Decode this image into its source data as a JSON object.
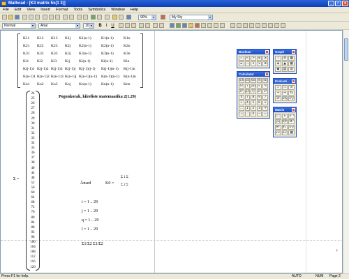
{
  "window": {
    "title": "Mathcad - [K3 matrix 5x(1 3)]"
  },
  "menu": [
    "File",
    "Edit",
    "View",
    "Insert",
    "Format",
    "Tools",
    "Symbolics",
    "Window",
    "Help"
  ],
  "toolbar": {
    "zoom": "90%",
    "style_combo": "My Sty"
  },
  "format_bar": {
    "style": "Normal",
    "font": "Arial",
    "size": "10",
    "bold": "B",
    "italic": "I",
    "underline": "U"
  },
  "matrix": {
    "rows": [
      [
        "K11",
        "K12",
        "K13",
        "K1j",
        "K1(n-1)",
        "K1(n-1)",
        "K1n"
      ],
      [
        "K21",
        "K22",
        "K23",
        "K2j",
        "K2(n-1)",
        "K2(n-1)",
        "K2n"
      ],
      [
        "K31",
        "K32",
        "K33",
        "K3j",
        "K3(n-1)",
        "K3(n-1)",
        "K3n"
      ],
      [
        "Ki1",
        "Ki2",
        "Ki3",
        "Kij",
        "Ki(n-1)",
        "Ki(n-1)",
        "Kin"
      ],
      [
        "K(j-1)1",
        "K(j-1)2",
        "K(j-1)3",
        "K(j-1)j",
        "K(j-1)(j-1)",
        "K(j-1)(n-1)",
        "K(j-1)n"
      ],
      [
        "K(n-1)1",
        "K(n-1)2",
        "K(n-1)3",
        "K(n-1)j",
        "K(n-1)(n-1)",
        "K(n-1)(n-1)",
        "K(n-1)n"
      ],
      [
        "Kn1",
        "Kn2",
        "Kn3",
        "Knj",
        "Kn(n-1)",
        "Kn(n-1)",
        "Knn"
      ]
    ]
  },
  "vector": {
    "label": "Σ =",
    "values": [
      "24",
      "25",
      "26",
      "27",
      "28",
      "29",
      "30",
      "31",
      "32",
      "33",
      "34",
      "35",
      "36",
      "37",
      "38",
      "40",
      "44",
      "48",
      "52",
      "56",
      "60",
      "64",
      "68",
      "72",
      "76",
      "80",
      "84",
      "88",
      "92",
      "96",
      "100",
      "104",
      "108",
      "112",
      "116",
      "120"
    ]
  },
  "notes": {
    "heading": "Pogonkorak, kiireliste matemaatika  2(1.29)",
    "ansed": "Ånsed",
    "k_eq": "K0 =",
    "frac_top": "Σ 1 Σ",
    "frac_bot": "Σ 2 Σ",
    "i_range": "i = 1 .. 29",
    "j_range": "j = 1 .. 29",
    "q_range": "q = 1 .. 29",
    "l_range": "l = 1 .. 29",
    "ratio": "Σ1/Σ2  Σ1/Σ2"
  },
  "palettes": {
    "boolean": {
      "title": "Boolean",
      "buttons": [
        "=",
        "<",
        ">",
        "≤",
        "≥",
        "≠",
        "¬",
        "∧",
        "∨",
        "⊕"
      ]
    },
    "graph": {
      "title": "Graph",
      "buttons": [
        "⌇",
        "⊛",
        "▦",
        "◈",
        "▲",
        "▦",
        "◆",
        "▤",
        "◍"
      ]
    },
    "calculator": {
      "title": "Calculator",
      "buttons": [
        "sin",
        "cos",
        "tan",
        "ln",
        "log",
        "n!",
        "i",
        "|x|",
        "√",
        "ⁿ√",
        "eˣ",
        "1/x",
        "()",
        "x²",
        "xʸ",
        "π",
        "7",
        "8",
        "9",
        "/",
        "÷",
        "4",
        "5",
        "6",
        "×",
        "…",
        "1",
        "2",
        "3",
        "+",
        ":=",
        ".",
        "0",
        "−",
        "="
      ]
    },
    "evaluation": {
      "title": "Evaluati...",
      "buttons": [
        "=",
        ":=",
        "≡",
        "→",
        "⇒",
        "fx",
        "xf",
        "xfy",
        "xᶠy"
      ]
    },
    "matrix": {
      "title": "Matrix",
      "buttons": [
        "[:::]",
        "x̄",
        "x⁻¹",
        "|x|",
        "f(M)",
        "M⁽⁾",
        "Mᵀ",
        "m..n",
        "x·y",
        "x×y",
        "Σv",
        "▦"
      ]
    }
  },
  "status": {
    "help": "Press F1 for help.",
    "mode": "AUTO",
    "num": "NUM",
    "page": "Page 2"
  }
}
